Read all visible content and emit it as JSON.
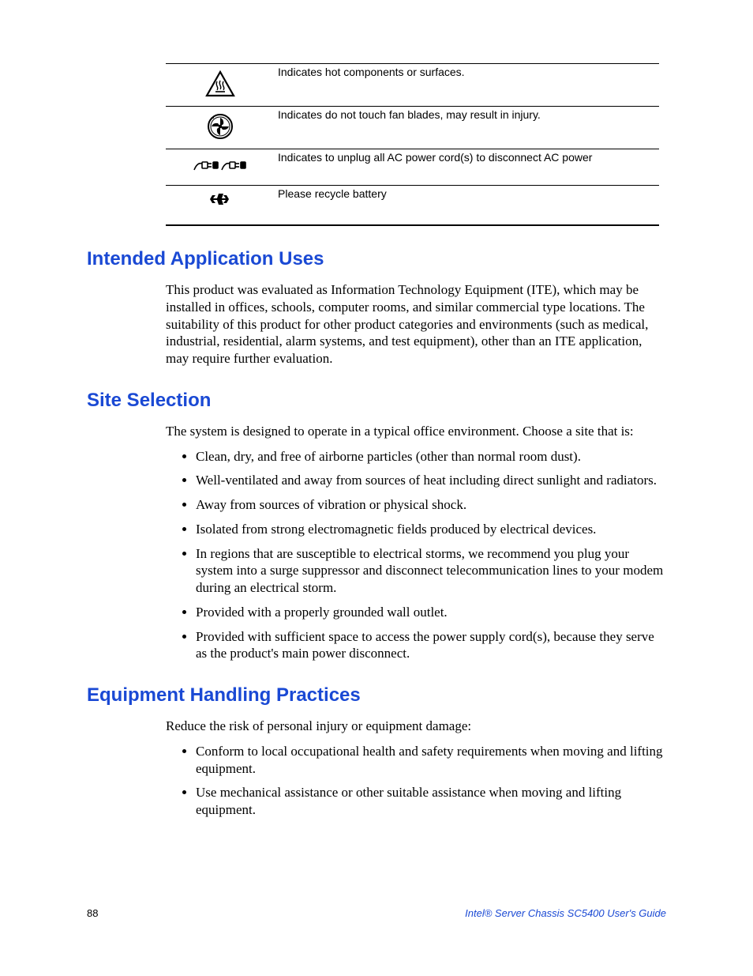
{
  "safety_table": {
    "rows": [
      {
        "icon": "hot-surface-icon",
        "text": "Indicates hot components or surfaces."
      },
      {
        "icon": "fan-blade-icon",
        "text": "Indicates do not touch fan blades, may result in injury."
      },
      {
        "icon": "unplug-cords-icon",
        "text": "Indicates to unplug all AC power cord(s) to disconnect AC power"
      },
      {
        "icon": "recycle-battery-icon",
        "text": "Please recycle battery"
      }
    ]
  },
  "sections": {
    "intended": {
      "heading": "Intended Application Uses",
      "paragraph": "This product was evaluated as Information Technology Equipment (ITE), which may be installed in offices, schools, computer rooms, and similar commercial type locations. The suitability of this product for other product categories and environments (such as medical, industrial, residential, alarm systems, and test equipment), other than an ITE application, may require further evaluation."
    },
    "site": {
      "heading": "Site Selection",
      "paragraph": "The system is designed to operate in a typical office environment. Choose a site that is:",
      "items": [
        "Clean, dry, and free of airborne particles (other than normal room dust).",
        "Well-ventilated and away from sources of heat including direct sunlight and radiators.",
        "Away from sources of vibration or physical shock.",
        "Isolated from strong electromagnetic fields produced by electrical devices.",
        "In regions that are susceptible to electrical storms, we recommend you plug your system into a surge suppressor and disconnect telecommunication lines to your modem during an electrical storm.",
        "Provided with a properly grounded wall outlet.",
        "Provided with sufficient space to access the power supply cord(s), because they serve as the product's main power disconnect."
      ]
    },
    "equipment": {
      "heading": "Equipment Handling Practices",
      "paragraph": "Reduce the risk of personal injury or equipment damage:",
      "items": [
        "Conform to local occupational health and safety requirements when moving and lifting equipment.",
        "Use mechanical assistance or other suitable assistance when moving and lifting equipment."
      ]
    }
  },
  "footer": {
    "page_number": "88",
    "doc_title": "Intel® Server Chassis SC5400 User's Guide"
  }
}
